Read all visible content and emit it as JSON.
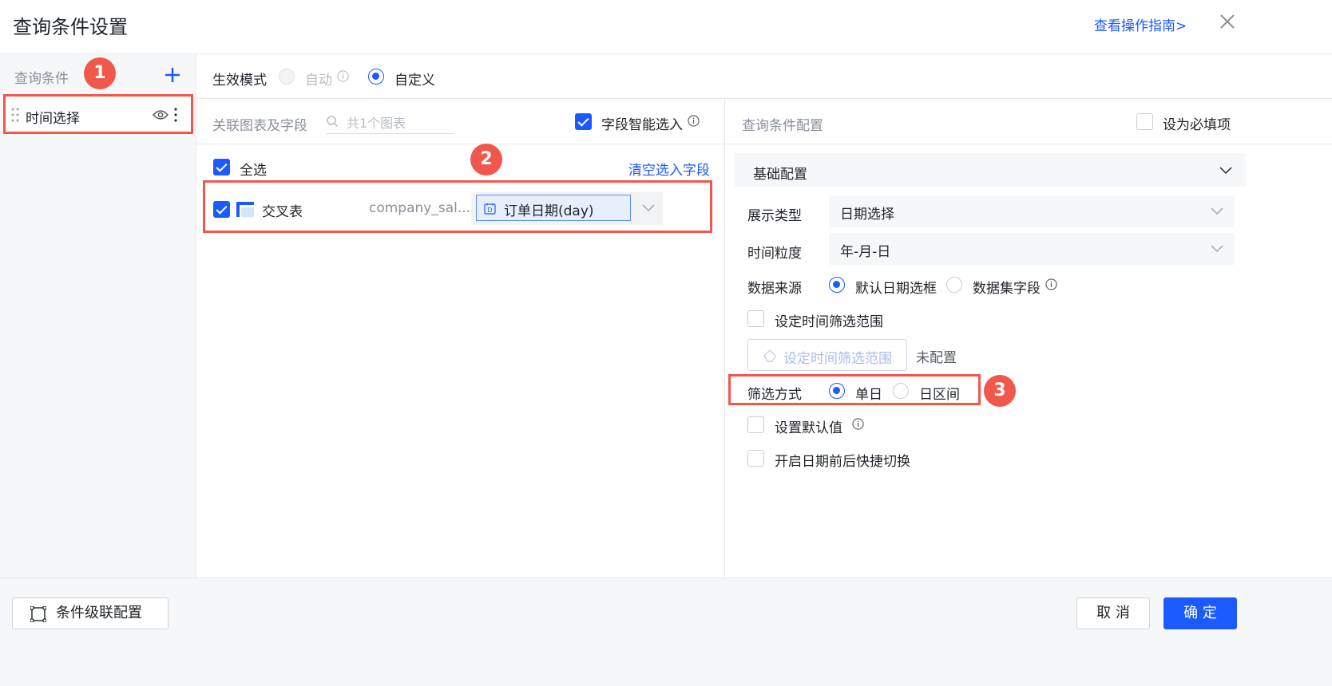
{
  "header": {
    "title": "查询条件设置",
    "guide_link": "查看操作指南>"
  },
  "left": {
    "title": "查询条件",
    "items": [
      {
        "label": "时间选择"
      }
    ]
  },
  "badges": [
    "1",
    "2",
    "3"
  ],
  "mode": {
    "label": "生效模式",
    "options": [
      {
        "label": "自动",
        "selected": false,
        "disabled": true
      },
      {
        "label": "自定义",
        "selected": true
      }
    ]
  },
  "middle": {
    "title": "关联图表及字段",
    "search_placeholder": "共1个图表",
    "smart_select": {
      "label": "字段智能选入",
      "checked": true
    },
    "select_all": {
      "label": "全选",
      "checked": true
    },
    "clear_link": "清空选入字段",
    "charts": [
      {
        "name": "交叉表",
        "dataset": "company_sal...",
        "field": "订单日期(day)",
        "checked": true
      }
    ]
  },
  "right": {
    "title": "查询条件配置",
    "required": {
      "label": "设为必填项",
      "checked": false
    },
    "section_title": "基础配置",
    "display_type": {
      "label": "展示类型",
      "value": "日期选择"
    },
    "granularity": {
      "label": "时间粒度",
      "value": "年-月-日"
    },
    "data_source": {
      "label": "数据来源",
      "options": [
        {
          "label": "默认日期选框",
          "selected": true
        },
        {
          "label": "数据集字段",
          "selected": false
        }
      ]
    },
    "time_range": {
      "label": "设定时间筛选范围",
      "checked": false,
      "button": "设定时间筛选范围",
      "status": "未配置"
    },
    "filter_mode": {
      "label": "筛选方式",
      "options": [
        {
          "label": "单日",
          "selected": true
        },
        {
          "label": "日区间",
          "selected": false
        }
      ]
    },
    "default_value": {
      "label": "设置默认值",
      "checked": false
    },
    "quick_switch": {
      "label": "开启日期前后快捷切换",
      "checked": false
    }
  },
  "footer": {
    "cascade": "条件级联配置",
    "cancel": "取 消",
    "confirm": "确 定"
  },
  "colors": {
    "accent": "#1b5aff",
    "highlight": "#f2574b"
  }
}
